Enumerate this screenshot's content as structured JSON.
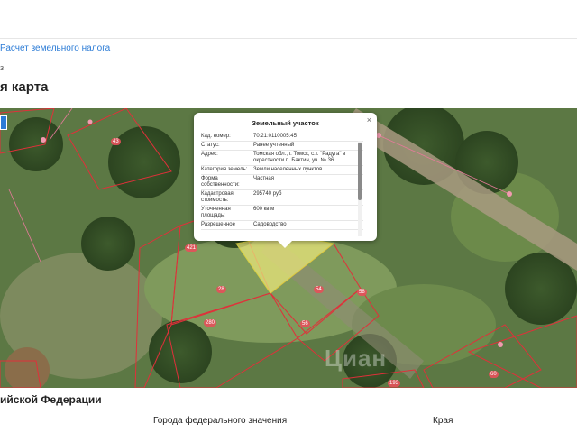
{
  "breadcrumb": {
    "link": "Расчет земельного налога"
  },
  "header": {
    "small_mark": "з",
    "title": "я карта"
  },
  "map": {
    "plot_labels": [
      "43",
      "421",
      "28",
      "54",
      "58",
      "280",
      "56",
      "60",
      "193"
    ],
    "watermark": "Циан"
  },
  "popup": {
    "title": "Земельный участок",
    "close": "×",
    "rows": [
      {
        "label": "Кад. номер:",
        "value": "70:21:0110005:45"
      },
      {
        "label": "Статус:",
        "value": "Ранее учтенный"
      },
      {
        "label": "Адрес:",
        "value": "Томская обл., г. Томск, с.т. \"Радуга\" в окрестности п. Бактин, уч. № 36"
      },
      {
        "label": "Категория земель:",
        "value": "Земли населенных пунктов"
      },
      {
        "label": "Форма собственности:",
        "value": "Частная"
      },
      {
        "label": "Кадастровая стоимость:",
        "value": "295740 руб"
      },
      {
        "label": "Уточненная площадь:",
        "value": "600 кв.м"
      },
      {
        "label": "Разрешенное",
        "value": "Садоводство"
      }
    ]
  },
  "section": {
    "title": "ийской Федерации",
    "col1": "Города федерального значения",
    "col2": "Края"
  }
}
